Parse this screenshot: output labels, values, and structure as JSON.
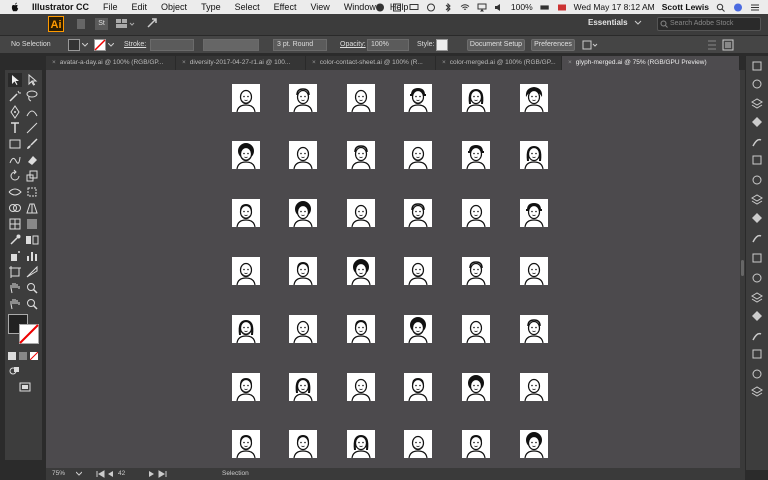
{
  "menubar": {
    "app_name": "Illustrator CC",
    "menus": [
      "File",
      "Edit",
      "Object",
      "Type",
      "Select",
      "Effect",
      "View",
      "Window",
      "Help"
    ],
    "battery": "100%",
    "datetime": "Wed May 17  8:12 AM",
    "user": "Scott Lewis"
  },
  "appbar": {
    "logo": "Ai",
    "bridge_label": "St",
    "workspace": "Essentials",
    "search_placeholder": "Search Adobe Stock"
  },
  "controlbar": {
    "selection_status": "No Selection",
    "stroke_label": "Stroke:",
    "stroke_profile": "3 pt. Round",
    "opacity_label": "Opacity:",
    "opacity_value": "100%",
    "style_label": "Style:",
    "document_setup": "Document Setup",
    "preferences": "Preferences"
  },
  "tabs": [
    {
      "label": "avatar-a-day.ai @ 100% (RGB/GP..."
    },
    {
      "label": "diversity-2017-04-27-r1.ai @ 100..."
    },
    {
      "label": "color-contact-sheet.ai @ 100% (R..."
    },
    {
      "label": "color-merged.ai @ 100% (RGB/GP..."
    },
    {
      "label": "glyph-merged.ai @ 75% (RGB/GPU Preview)",
      "active": true
    }
  ],
  "statusbar": {
    "zoom": "75%",
    "artboard": "42",
    "tool": "Selection"
  },
  "colors": {
    "canvas": "#4c4a4d",
    "panel": "#3d3d3d",
    "accent": "#ff9a00"
  },
  "avatar_grid": {
    "rows": 7,
    "cols": 6,
    "icon": "person-glyph-icon"
  }
}
